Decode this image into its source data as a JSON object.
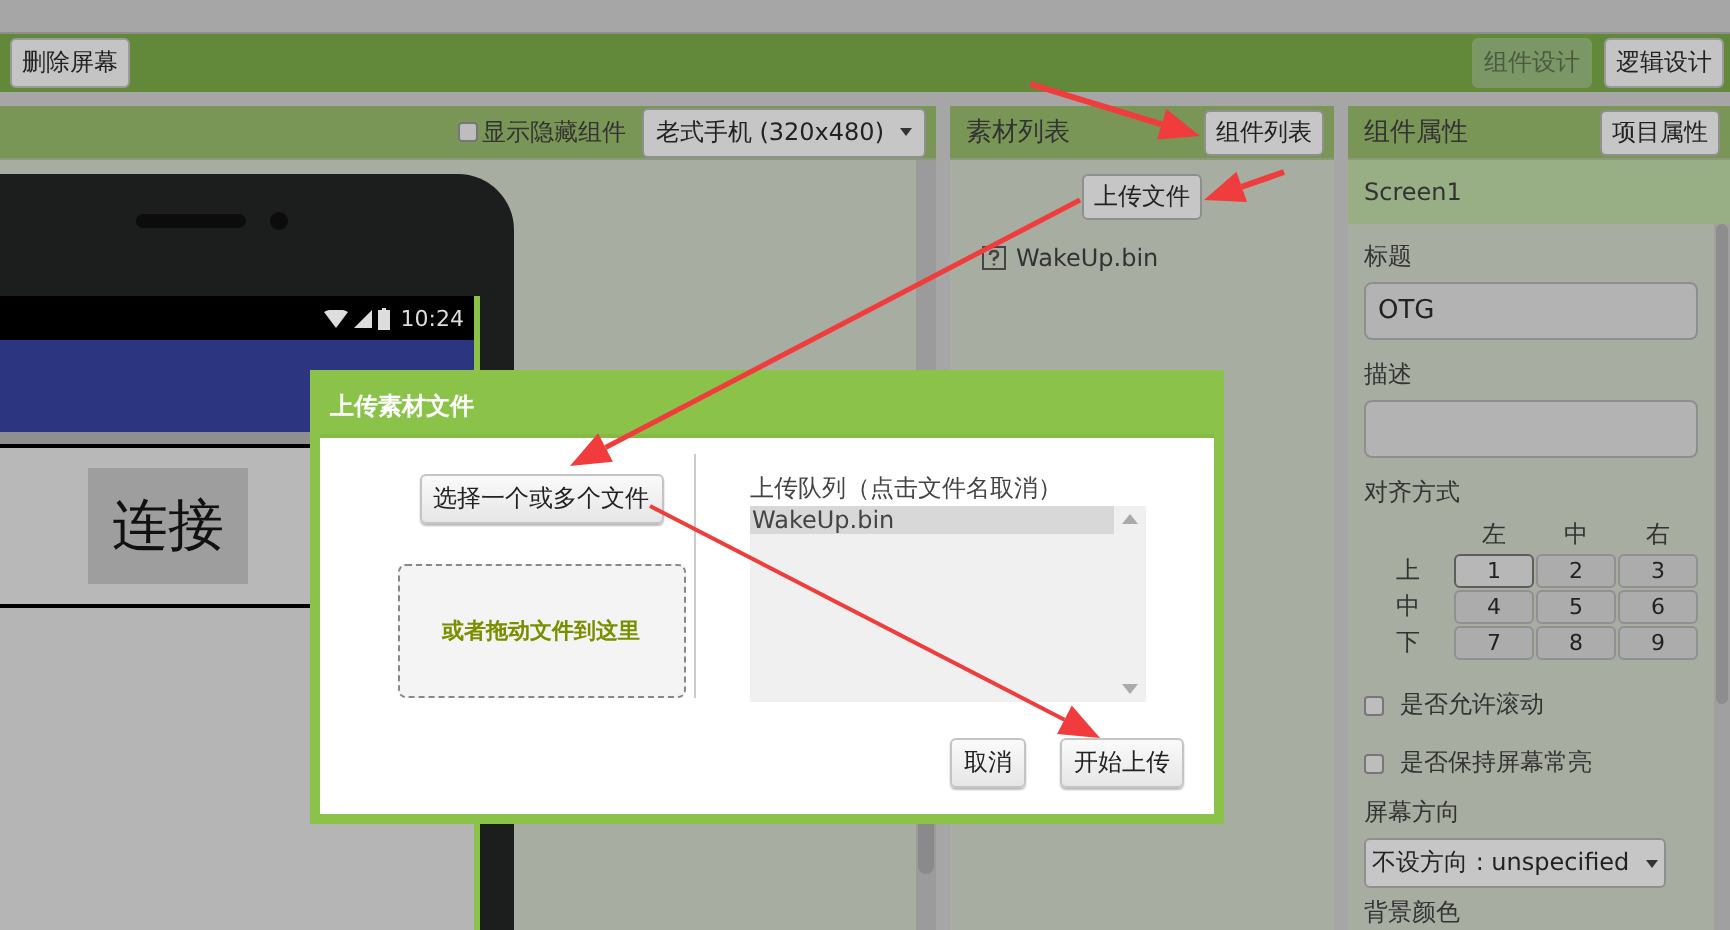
{
  "toolbar": {
    "left_buttons": [
      {
        "label": "删除屏幕"
      }
    ],
    "right_buttons": [
      {
        "label": "组件设计",
        "disabled": true
      },
      {
        "label": "逻辑设计",
        "disabled": false
      }
    ]
  },
  "viewer": {
    "show_hidden": {
      "label": "显示隐藏组件",
      "checked": false
    },
    "device_select": "老式手机 (320x480)",
    "phone": {
      "time": "10:24",
      "button": "连接"
    }
  },
  "assets": {
    "title": "素材列表",
    "toggle_button": "组件列表",
    "upload_button": "上传文件",
    "files": [
      {
        "name": "WakeUp.bin"
      }
    ]
  },
  "properties": {
    "title": "组件属性",
    "project_button": "项目属性",
    "component": "Screen1",
    "fields": [
      {
        "label": "标题",
        "value": "OTG",
        "kind": "text"
      },
      {
        "label": "描述",
        "kind": "textarea"
      }
    ],
    "alignment": {
      "label": "对齐方式",
      "columns": [
        "左",
        "中",
        "右"
      ],
      "rows": [
        {
          "label": "上",
          "cells": [
            {
              "text": "1",
              "selected": true
            },
            {
              "text": "2",
              "selected": false
            },
            {
              "text": "3",
              "selected": false
            }
          ]
        },
        {
          "label": "中",
          "cells": [
            {
              "text": "4",
              "selected": false
            },
            {
              "text": "5",
              "selected": false
            },
            {
              "text": "6",
              "selected": false
            }
          ]
        },
        {
          "label": "下",
          "cells": [
            {
              "text": "7",
              "selected": false
            },
            {
              "text": "8",
              "selected": false
            },
            {
              "text": "9",
              "selected": false
            }
          ]
        }
      ]
    },
    "checkboxes": [
      {
        "label": "是否允许滚动",
        "checked": false
      },
      {
        "label": "是否保持屏幕常亮",
        "checked": false
      }
    ],
    "orientation": {
      "label": "屏幕方向",
      "value": "不设方向 : unspecified"
    },
    "background_label": "背景颜色"
  },
  "dialog": {
    "title": "上传素材文件",
    "choose_button": "选择一个或多个文件",
    "drop_zone": "或者拖动文件到这里",
    "queue_label": "上传队列（点击文件名取消）",
    "queue": [
      {
        "name": "WakeUp.bin",
        "selected": true
      }
    ],
    "buttons": [
      {
        "label": "取消"
      },
      {
        "label": "开始上传"
      }
    ]
  }
}
